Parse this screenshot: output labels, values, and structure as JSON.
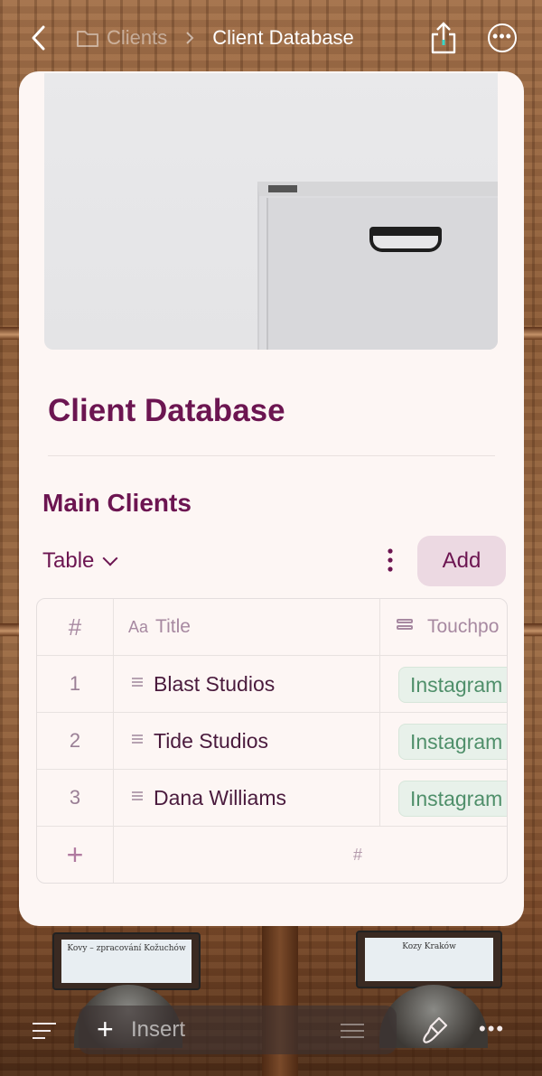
{
  "nav": {
    "breadcrumb_parent": "Clients",
    "breadcrumb_separator": ">",
    "breadcrumb_current": "Client Database",
    "more_glyph": "•••"
  },
  "page": {
    "title": "Client Database",
    "section_title": "Main Clients",
    "view_select": "Table",
    "add_button": "Add"
  },
  "table": {
    "headers": {
      "num": "#",
      "title_prefix": "Aa",
      "title": "Title",
      "touchpoints": "Touchpo"
    },
    "rows": [
      {
        "num": "1",
        "title": "Blast Studios",
        "touchpoint": "Instagram"
      },
      {
        "num": "2",
        "title": "Tide Studios",
        "touchpoint": "Instagram"
      },
      {
        "num": "3",
        "title": "Dana Williams",
        "touchpoint": "Instagram"
      }
    ],
    "add_row_glyph": "+",
    "footer_hash": "#"
  },
  "background_labels": {
    "left": "Kovy – zpracování Kožuchów",
    "right": "Kozy Kraków"
  },
  "bottombar": {
    "insert_label": "Insert",
    "more_glyph": "•••"
  },
  "colors": {
    "accent": "#6c1551",
    "tag_bg": "#e8f1ea",
    "tag_text": "#4f8f6a",
    "card_bg": "#fdf6f4"
  }
}
